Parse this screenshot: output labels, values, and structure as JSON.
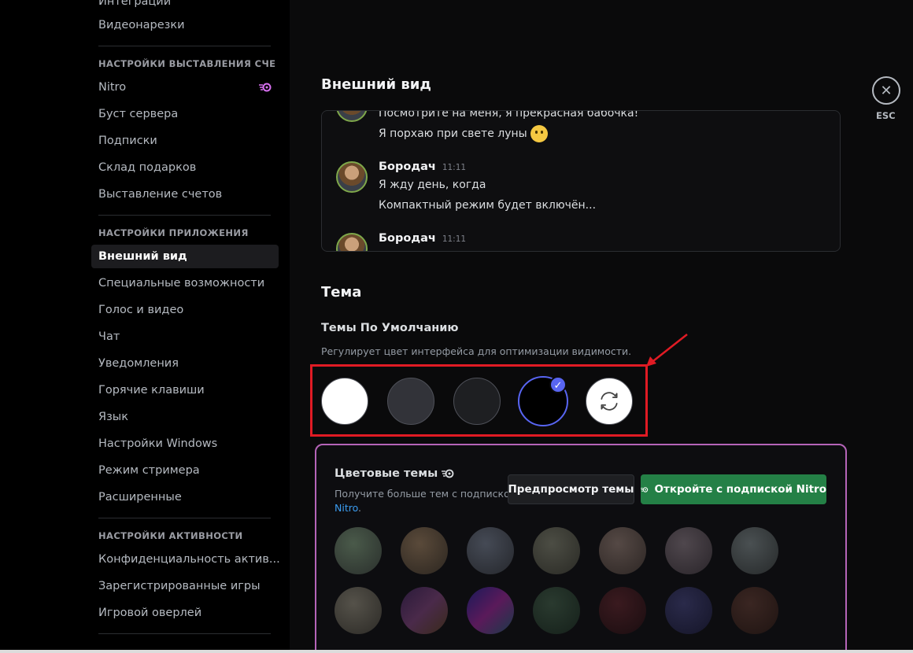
{
  "sidebar": {
    "top_items": [
      {
        "label": "Интеграции"
      },
      {
        "label": "Видеонарезки"
      }
    ],
    "billing": {
      "header": "НАСТРОЙКИ ВЫСТАВЛЕНИЯ СЧЕТ...",
      "items": [
        {
          "label": "Nitro",
          "icon": "nitro-icon"
        },
        {
          "label": "Буст сервера"
        },
        {
          "label": "Подписки"
        },
        {
          "label": "Склад подарков"
        },
        {
          "label": "Выставление счетов"
        }
      ]
    },
    "app": {
      "header": "НАСТРОЙКИ ПРИЛОЖЕНИЯ",
      "items": [
        {
          "label": "Внешний вид",
          "active": true
        },
        {
          "label": "Специальные возможности"
        },
        {
          "label": "Голос и видео"
        },
        {
          "label": "Чат"
        },
        {
          "label": "Уведомления"
        },
        {
          "label": "Горячие клавиши"
        },
        {
          "label": "Язык"
        },
        {
          "label": "Настройки Windows"
        },
        {
          "label": "Режим стримера"
        },
        {
          "label": "Расширенные"
        }
      ]
    },
    "activity": {
      "header": "НАСТРОЙКИ АКТИВНОСТИ",
      "items": [
        {
          "label": "Конфиденциальность актив..."
        },
        {
          "label": "Зарегистрированные игры"
        },
        {
          "label": "Игровой оверлей"
        }
      ]
    }
  },
  "main": {
    "title": "Внешний вид",
    "preview": {
      "messages": [
        {
          "line": "Посмотрите на меня, я прекрасная бабочка!"
        },
        {
          "line": "Я порхаю при свете луны"
        },
        {
          "author": "Бородач",
          "time": "11:11",
          "lines": [
            "Я жду день, когда",
            "Компактный режим будет включён..."
          ]
        },
        {
          "author": "Бородач",
          "time": "11:11"
        }
      ]
    },
    "theme": {
      "title": "Тема",
      "default_label": "Темы По Умолчанию",
      "default_desc": "Регулирует цвет интерфейса для оптимизации видимости.",
      "options": [
        {
          "name": "light",
          "color": "#ffffff"
        },
        {
          "name": "ash",
          "color": "#323339"
        },
        {
          "name": "dark",
          "color": "#1e1f22"
        },
        {
          "name": "onyx",
          "color": "#000000",
          "selected": true
        },
        {
          "name": "sync",
          "color": "#ffffff",
          "icon": "sync-icon"
        }
      ]
    },
    "nitro_themes": {
      "title": "Цветовые темы",
      "desc": "Получите больше тем с подпиской",
      "link": "Nitro",
      "link_suffix": ".",
      "preview_button": "Предпросмотр темы",
      "unlock_button": "Откройте с подпиской Nitro"
    },
    "close": {
      "label": "ESC"
    }
  },
  "colors": {
    "accent": "#5865f2",
    "green": "#248046",
    "highlight": "#e01b24",
    "nitro_border": "#b564b8"
  }
}
